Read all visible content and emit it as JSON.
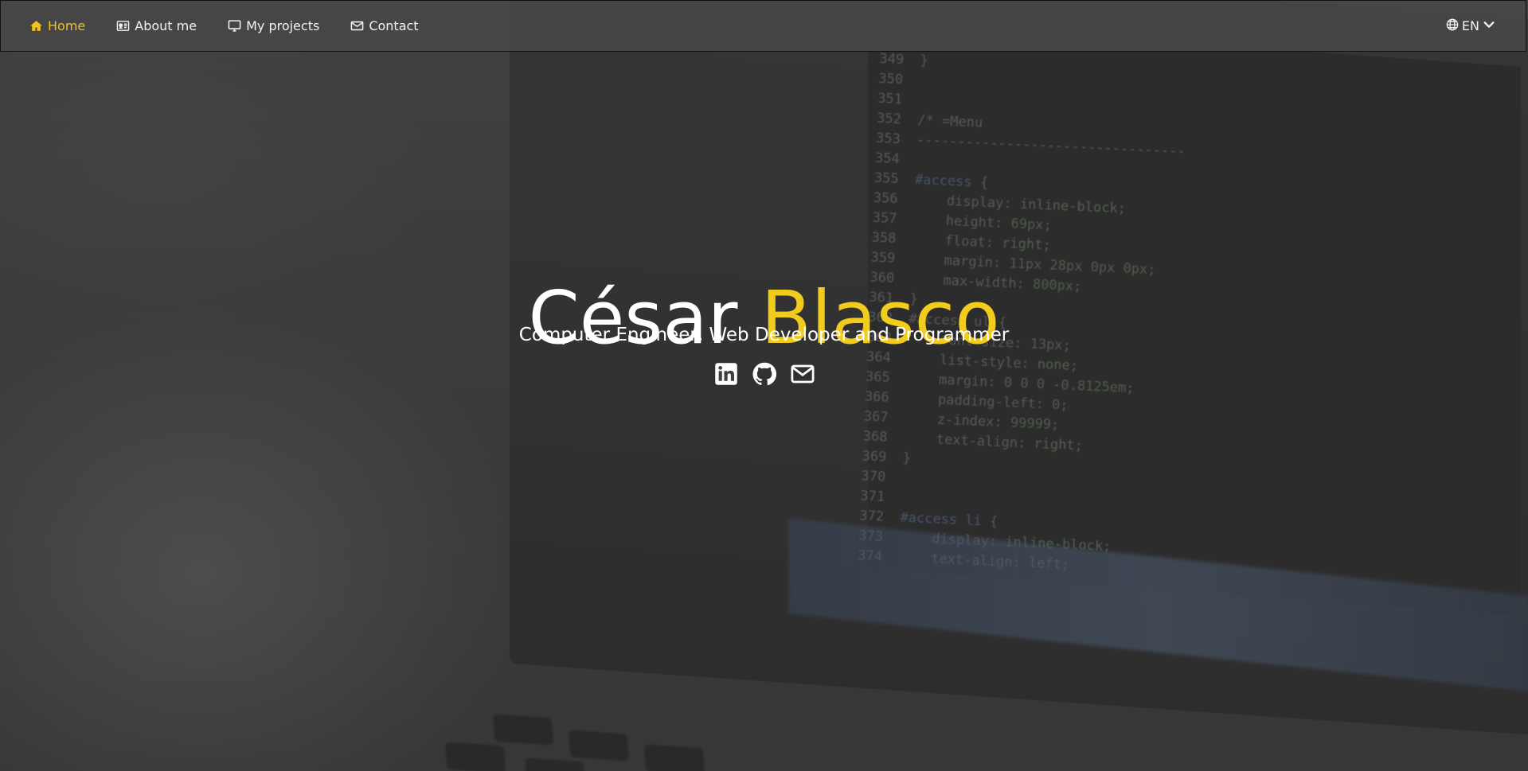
{
  "nav": {
    "items": [
      {
        "label": "Home",
        "icon": "home-icon",
        "active": true
      },
      {
        "label": "About me",
        "icon": "id-card-icon",
        "active": false
      },
      {
        "label": "My projects",
        "icon": "desktop-icon",
        "active": false
      },
      {
        "label": "Contact",
        "icon": "envelope-icon",
        "active": false
      }
    ],
    "language": {
      "label": "EN",
      "icon": "globe-icon",
      "caret": "chevron-down-icon"
    }
  },
  "hero": {
    "first_name": "César",
    "last_name": "Blasco",
    "subtitle": "Computer Engineer, Web Developer and Programmer",
    "social": [
      {
        "name": "linkedin",
        "icon": "linkedin-icon"
      },
      {
        "name": "github",
        "icon": "github-icon"
      },
      {
        "name": "email",
        "icon": "envelope-icon"
      }
    ]
  },
  "colors": {
    "accent": "#f0c21c",
    "navbar": "#464646",
    "text": "#ffffff"
  }
}
